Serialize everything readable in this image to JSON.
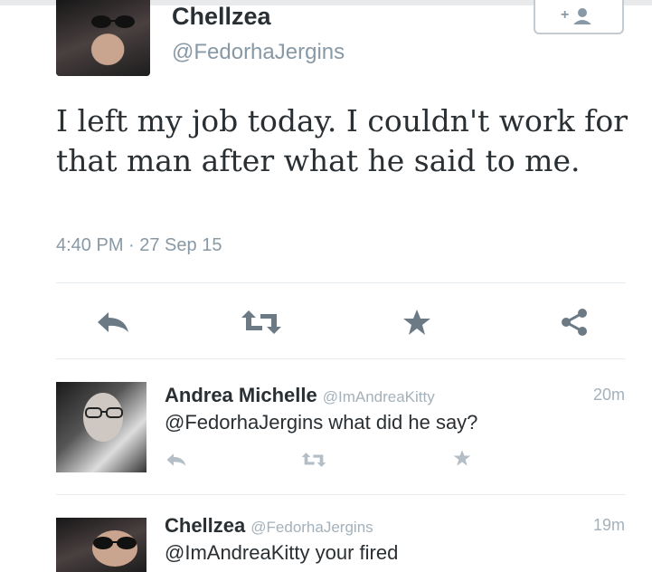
{
  "tweet": {
    "name": "Chellzea",
    "handle": "@FedorhaJergins",
    "text": "I left my job today. I couldn't work for that man after what he said to me.",
    "timestamp": "4:40 PM · 27 Sep 15",
    "follow_icon": "add-user-icon",
    "actions": [
      "reply-icon",
      "retweet-icon",
      "favorite-icon",
      "share-icon"
    ]
  },
  "replies": [
    {
      "name": "Andrea Michelle",
      "handle": "@ImAndreaKitty",
      "text": "@FedorhaJergins what did he say?",
      "time": "20m"
    },
    {
      "name": "Chellzea",
      "handle": "@FedorhaJergins",
      "text": "@ImAndreaKitty your fired",
      "time": "19m"
    }
  ],
  "colors": {
    "text": "#292f33",
    "muted": "#8899a6",
    "icon": "#6c7a85",
    "border": "#e6ecf0"
  }
}
